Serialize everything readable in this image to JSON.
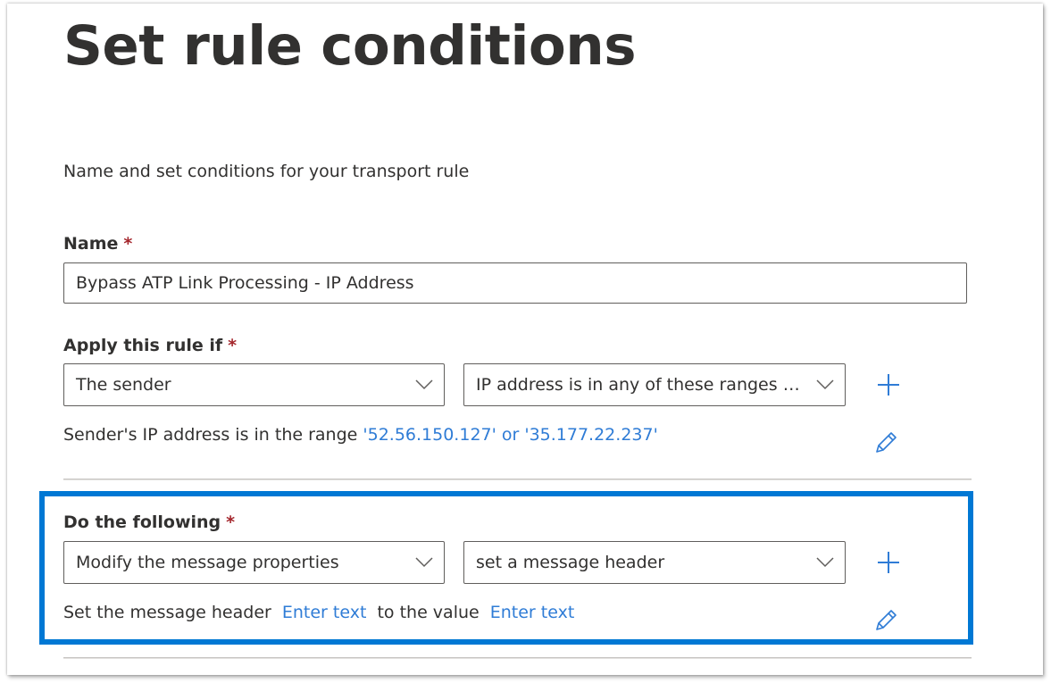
{
  "page": {
    "title": "Set rule conditions",
    "subtitle": "Name and set conditions for your transport rule"
  },
  "name_field": {
    "label": "Name",
    "required_mark": "*",
    "value": "Bypass ATP Link Processing - IP Address"
  },
  "condition": {
    "label": "Apply this rule if",
    "required_mark": "*",
    "dropdown1": "The sender",
    "dropdown2": "IP address is in any of these ranges or...",
    "description_prefix": "Sender's IP address is in the range ",
    "description_link": "'52.56.150.127' or '35.177.22.237'"
  },
  "action": {
    "label": "Do the following",
    "required_mark": "*",
    "dropdown1": "Modify the message properties",
    "dropdown2": "set a message header",
    "desc_part1": "Set the message header",
    "link1": "Enter text",
    "desc_part2": "to the value",
    "link2": "Enter text"
  },
  "colors": {
    "accent": "#0078d4",
    "link": "#2f7cd6",
    "required": "#a4262c"
  },
  "icons": {
    "dropdown": "chevron-down-icon",
    "add": "plus-icon",
    "edit": "pencil-icon"
  }
}
